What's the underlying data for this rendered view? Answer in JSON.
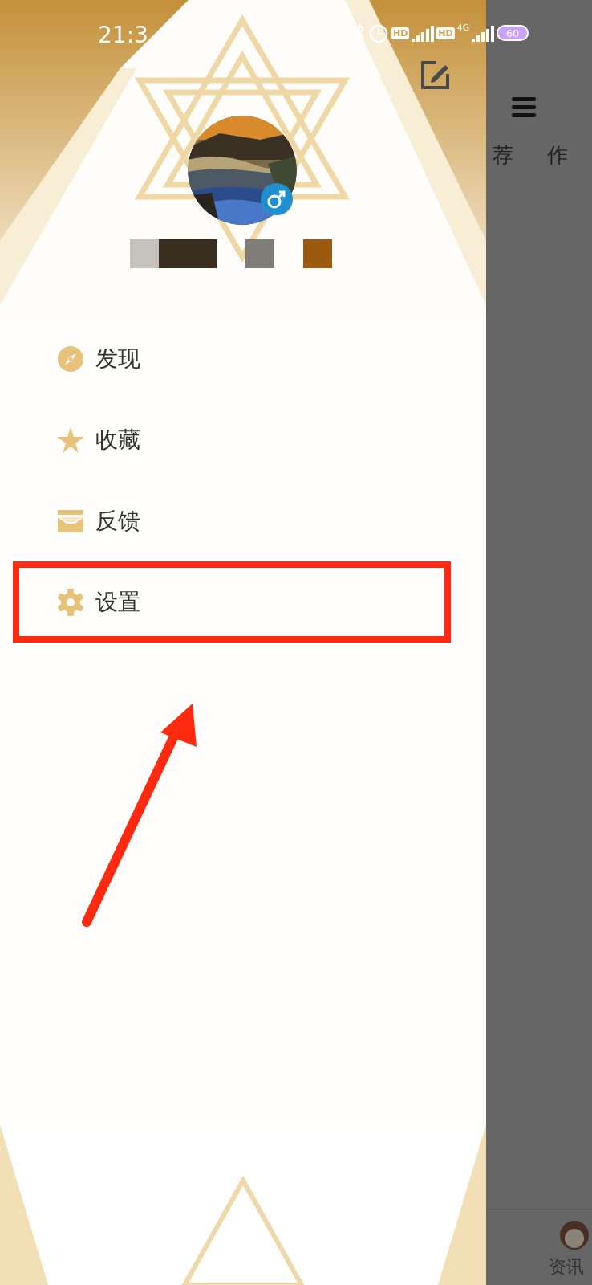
{
  "status_bar": {
    "time": "21:3",
    "labels": [
      "HD",
      "HD",
      "4G"
    ],
    "battery": "60"
  },
  "name_blocks": [
    {
      "kind": "block",
      "color": "#c4c3bd"
    },
    {
      "kind": "block",
      "color": "#3a2e1e"
    },
    {
      "kind": "block",
      "color": "#3a2e1e"
    },
    {
      "kind": "gap"
    },
    {
      "kind": "block",
      "color": "#807d76"
    },
    {
      "kind": "gap"
    },
    {
      "kind": "block",
      "color": "#9c5a10"
    }
  ],
  "menu": [
    {
      "kind": "compass",
      "label": "发现",
      "highlighted": false
    },
    {
      "kind": "star",
      "label": "收藏",
      "highlighted": false
    },
    {
      "kind": "inbox",
      "label": "反馈",
      "highlighted": false
    },
    {
      "kind": "gear",
      "label": "设置",
      "highlighted": true
    }
  ],
  "background_tabs": [
    {
      "label": "荐"
    },
    {
      "label": "作"
    }
  ],
  "bottom_tab": {
    "label": "资讯"
  }
}
